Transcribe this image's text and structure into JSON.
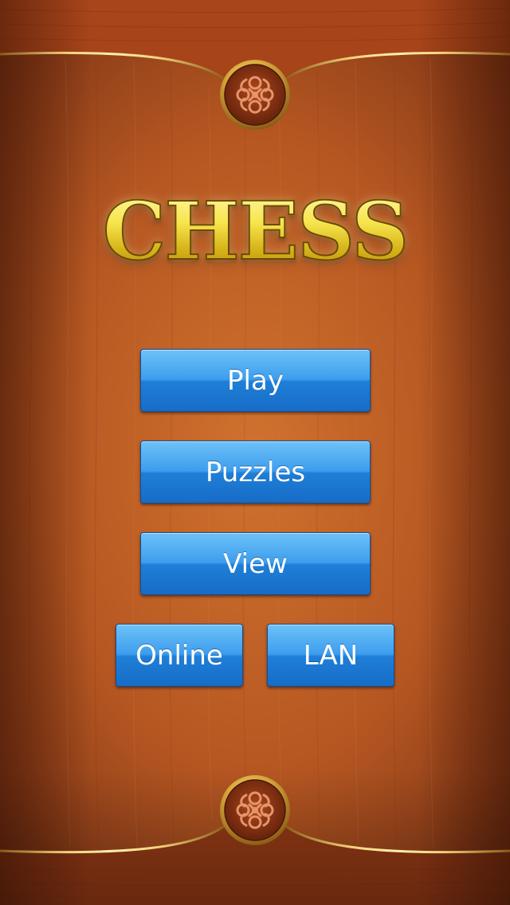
{
  "app": {
    "title": "CHESS"
  },
  "menu": {
    "play_label": "Play",
    "puzzles_label": "Puzzles",
    "view_label": "View",
    "online_label": "Online",
    "lan_label": "LAN"
  },
  "colors": {
    "wood_light": "#c86a2a",
    "wood_dark": "#6b2a12",
    "gold_trim": "#e6b84a",
    "title_gold": "#f4e25c",
    "button_blue_top": "#6ec1f7",
    "button_blue_bottom": "#176cc6"
  },
  "icons": {
    "top_ornament": "knot-medallion-icon",
    "bottom_ornament": "knot-medallion-icon"
  }
}
